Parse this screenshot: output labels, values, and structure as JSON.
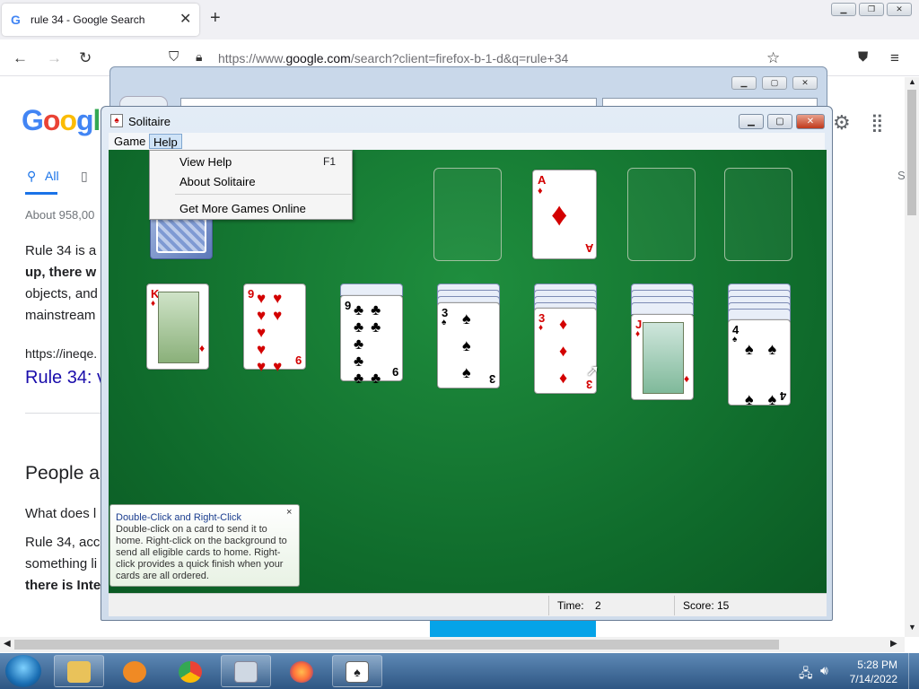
{
  "browser": {
    "tab_title": "rule 34 - Google Search",
    "tab_favicon": "G",
    "url_prefix": "https://www.",
    "url_domain": "google.com",
    "url_rest": "/search?client=firefox-b-1-d&q=rule+34"
  },
  "google": {
    "logo_text": "Google",
    "tab_all": "All",
    "about": "About 958,00",
    "line1": "Rule 34 is a",
    "line2": "up, there w",
    "line3": "objects, and",
    "line4": "mainstream",
    "url_line": "https://ineqe.",
    "link": "Rule 34: v",
    "people": "People a",
    "q1": "What does l",
    "q2a": "Rule 34, acc",
    "q2b": "something li",
    "q2c": "there is Inte",
    "side_s": "S"
  },
  "solitaire": {
    "title": "Solitaire",
    "menu_game": "Game",
    "menu_help": "Help",
    "help_menu": {
      "view_help": "View Help",
      "view_help_key": "F1",
      "about": "About Solitaire",
      "more_games": "Get More Games Online"
    },
    "tip": {
      "title": "Double-Click and Right-Click",
      "body": "Double-click on a card to send it to home. Right-click on the background to send all eligible cards to home. Right-click provides a quick finish when your cards are all ordered.",
      "close": "×"
    },
    "status": {
      "time_label": "Time:",
      "time_value": "2",
      "score_label": "Score:",
      "score_value": "15"
    },
    "foundation_card": {
      "rank": "A",
      "suit": "♦"
    },
    "tableau": [
      {
        "rank": "K",
        "suit": "♦"
      },
      {
        "rank": "9",
        "suit": "♥"
      },
      {
        "rank": "9",
        "suit": "♣"
      },
      {
        "rank": "3",
        "suit": "♠"
      },
      {
        "rank": "3",
        "suit": "♦"
      },
      {
        "rank": "J",
        "suit": "♦"
      },
      {
        "rank": "4",
        "suit": "♠"
      }
    ]
  },
  "taskbar": {
    "time": "5:28 PM",
    "date": "7/14/2022"
  },
  "colors": {
    "felt": "#0f6a2b",
    "red_suit": "#d30000",
    "google_blue": "#4285f4"
  }
}
